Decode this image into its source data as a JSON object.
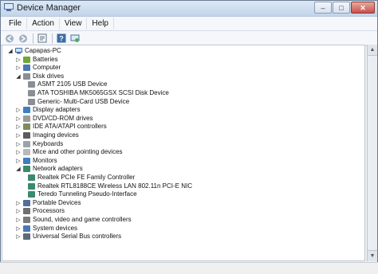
{
  "window": {
    "title": "Device Manager"
  },
  "menu": [
    "File",
    "Action",
    "View",
    "Help"
  ],
  "toolbar": {
    "buttons": [
      "back-arrow-icon",
      "forward-arrow-icon",
      "properties-sheet-icon",
      "help-icon",
      "update-driver-icon"
    ]
  },
  "colors": {
    "accent": "#3a6ea5",
    "title_bar": "#c3d5ea",
    "close": "#c75050"
  },
  "tree": {
    "root": "Capapas-PC",
    "nodes": [
      {
        "label": "Batteries",
        "level": 1,
        "expanded": false,
        "icon": "battery-icon",
        "color": "#6fa832"
      },
      {
        "label": "Computer",
        "level": 1,
        "expanded": false,
        "icon": "computer-icon",
        "color": "#4a78b5"
      },
      {
        "label": "Disk drives",
        "level": 1,
        "expanded": true,
        "icon": "disk-drive-icon",
        "color": "#8a8f96"
      },
      {
        "label": "ASMT 2105 USB Device",
        "level": 2,
        "icon": "disk-drive-icon",
        "color": "#8a8f96"
      },
      {
        "label": "ATA TOSHIBA MK5065GSX SCSI Disk Device",
        "level": 2,
        "icon": "disk-drive-icon",
        "color": "#8a8f96"
      },
      {
        "label": "Generic- Multi-Card USB Device",
        "level": 2,
        "icon": "disk-drive-icon",
        "color": "#8a8f96"
      },
      {
        "label": "Display adapters",
        "level": 1,
        "expanded": false,
        "icon": "display-adapter-icon",
        "color": "#3d7fc1"
      },
      {
        "label": "DVD/CD-ROM drives",
        "level": 1,
        "expanded": false,
        "icon": "dvd-drive-icon",
        "color": "#9a9a9a"
      },
      {
        "label": "IDE ATA/ATAPI controllers",
        "level": 1,
        "expanded": false,
        "icon": "ide-controller-icon",
        "color": "#7d8c5a"
      },
      {
        "label": "Imaging devices",
        "level": 1,
        "expanded": false,
        "icon": "camera-icon",
        "color": "#5c5c5c"
      },
      {
        "label": "Keyboards",
        "level": 1,
        "expanded": false,
        "icon": "keyboard-icon",
        "color": "#9aa3ad"
      },
      {
        "label": "Mice and other pointing devices",
        "level": 1,
        "expanded": false,
        "icon": "mouse-icon",
        "color": "#b9b9b9"
      },
      {
        "label": "Monitors",
        "level": 1,
        "expanded": false,
        "icon": "monitor-icon",
        "color": "#3d7fc1"
      },
      {
        "label": "Network adapters",
        "level": 1,
        "expanded": true,
        "icon": "network-adapter-icon",
        "color": "#3a8a6e"
      },
      {
        "label": "Realtek PCIe FE Family Controller",
        "level": 2,
        "icon": "network-adapter-icon",
        "color": "#3a8a6e"
      },
      {
        "label": "Realtek RTL8188CE Wireless LAN 802.11n PCI-E NIC",
        "level": 2,
        "icon": "network-adapter-icon",
        "color": "#3a8a6e"
      },
      {
        "label": "Teredo Tunneling Pseudo-Interface",
        "level": 2,
        "icon": "network-adapter-icon",
        "color": "#3a8a6e"
      },
      {
        "label": "Portable Devices",
        "level": 1,
        "expanded": false,
        "icon": "portable-device-icon",
        "color": "#4f6f9a"
      },
      {
        "label": "Processors",
        "level": 1,
        "expanded": false,
        "icon": "processor-icon",
        "color": "#6f6f6f"
      },
      {
        "label": "Sound, video and game controllers",
        "level": 1,
        "expanded": false,
        "icon": "speaker-icon",
        "color": "#7a7a7a"
      },
      {
        "label": "System devices",
        "level": 1,
        "expanded": false,
        "icon": "system-device-icon",
        "color": "#4a78b5"
      },
      {
        "label": "Universal Serial Bus controllers",
        "level": 1,
        "expanded": false,
        "icon": "usb-icon",
        "color": "#5f6a78"
      }
    ]
  }
}
